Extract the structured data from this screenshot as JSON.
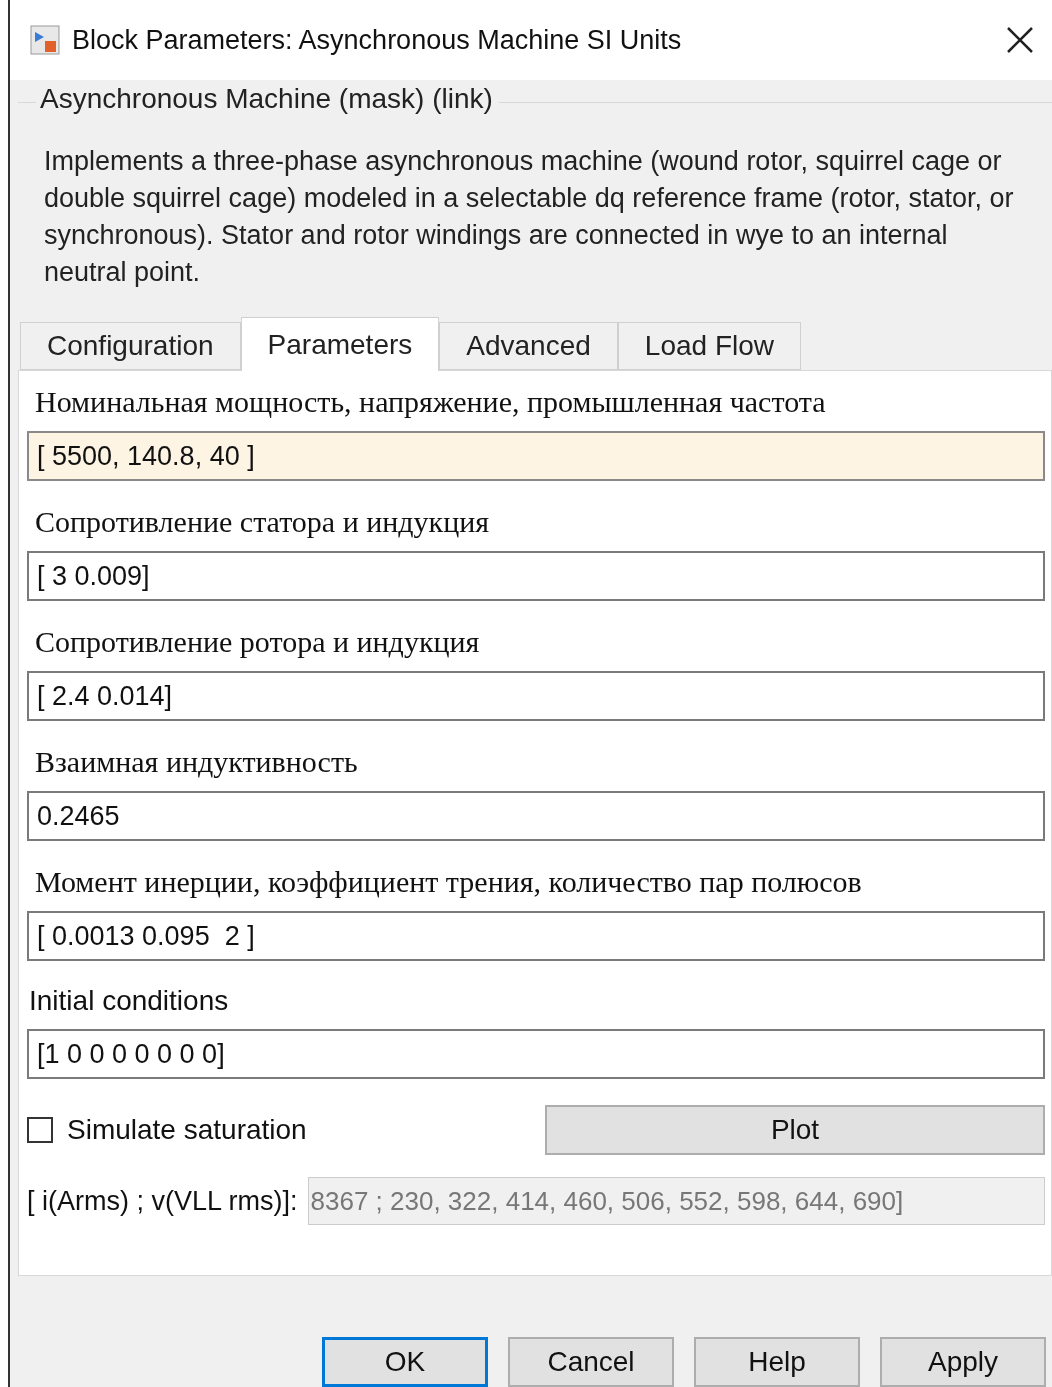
{
  "window": {
    "title": "Block Parameters: Asynchronous Machine SI Units"
  },
  "group": {
    "legend": "Asynchronous Machine (mask) (link)",
    "description": "Implements a three-phase asynchronous machine (wound rotor, squirrel cage or double squirrel cage) modeled in a selectable dq reference frame (rotor, stator, or synchronous). Stator and rotor windings are connected in wye to an internal neutral point."
  },
  "tabs": [
    {
      "label": "Configuration",
      "selected": false
    },
    {
      "label": "Parameters",
      "selected": true
    },
    {
      "label": "Advanced",
      "selected": false
    },
    {
      "label": "Load Flow",
      "selected": false
    }
  ],
  "fields": [
    {
      "label": "Номинальная мощность, напряжение, промышленная частота",
      "kind": "serif",
      "value": "[ 5500, 140.8, 40 ]",
      "focused": true
    },
    {
      "label": "Сопротивление статора и индукция",
      "kind": "serif",
      "value": "[ 3 0.009]",
      "focused": false
    },
    {
      "label": "Сопротивление ротора и индукция",
      "kind": "serif",
      "value": "[ 2.4 0.014]",
      "focused": false
    },
    {
      "label": "Взаимная индуктивность",
      "kind": "serif",
      "value": "0.2465",
      "focused": false
    },
    {
      "label": "Момент инерции, коэффициент трения, количество пар полюсов",
      "kind": "serif",
      "value": "[ 0.0013 0.095  2 ]",
      "focused": false
    },
    {
      "label": "Initial conditions",
      "kind": "sans",
      "value": "[1 0 0 0 0 0 0 0]",
      "focused": false
    }
  ],
  "saturation": {
    "label": "Simulate saturation",
    "checked": false,
    "plot_button": "Plot"
  },
  "saturation_data": {
    "label": "[ i(Arms) ; v(VLL rms)]:",
    "value": "8367 ; 230, 322, 414, 460, 506, 552, 598, 644, 690]",
    "disabled": true
  },
  "buttons": [
    {
      "label": "OK",
      "default": true
    },
    {
      "label": "Cancel",
      "default": false
    },
    {
      "label": "Help",
      "default": false
    },
    {
      "label": "Apply",
      "default": false
    }
  ]
}
